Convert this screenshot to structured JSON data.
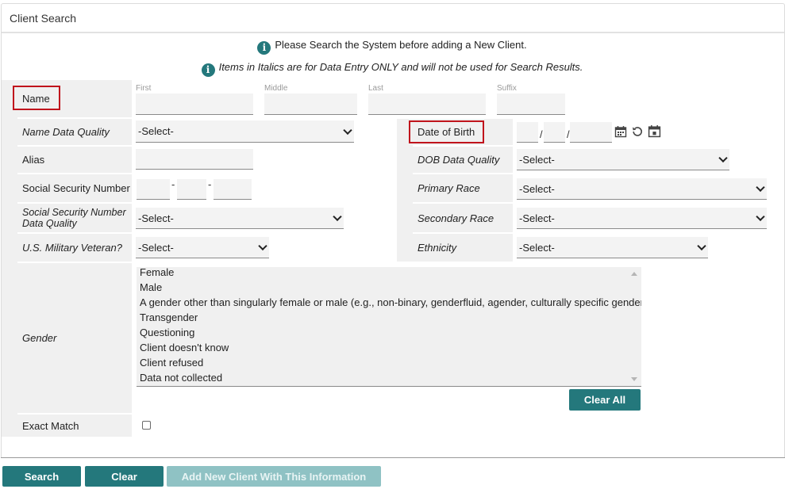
{
  "header": {
    "title": "Client Search"
  },
  "info": {
    "line1": "Please Search the System before adding a New Client.",
    "line2": "Items in Italics are for Data Entry ONLY and will not be used for Search Results.",
    "icon": "i"
  },
  "name": {
    "label": "Name",
    "first_label": "First",
    "middle_label": "Middle",
    "last_label": "Last",
    "suffix_label": "Suffix"
  },
  "fields": {
    "name_data_quality": {
      "label": "Name Data Quality",
      "value": "-Select-"
    },
    "alias": {
      "label": "Alias"
    },
    "ssn": {
      "label": "Social Security Number",
      "sep": "-"
    },
    "ssn_quality": {
      "label": "Social Security Number Data Quality",
      "value": "-Select-"
    },
    "veteran": {
      "label": "U.S. Military Veteran?",
      "value": "-Select-"
    },
    "gender": {
      "label": "Gender"
    },
    "exact_match": {
      "label": "Exact Match"
    },
    "dob": {
      "label": "Date of Birth",
      "sep": "/"
    },
    "dob_quality": {
      "label": "DOB Data Quality",
      "value": "-Select-"
    },
    "primary_race": {
      "label": "Primary Race",
      "value": "-Select-"
    },
    "secondary_race": {
      "label": "Secondary Race",
      "value": "-Select-"
    },
    "ethnicity": {
      "label": "Ethnicity",
      "value": "-Select-"
    }
  },
  "gender_options": [
    "Female",
    "Male",
    "A gender other than singularly female or male (e.g., non-binary, genderfluid, agender, culturally specific gender)",
    "Transgender",
    "Questioning",
    "Client doesn't know",
    "Client refused",
    "Data not collected"
  ],
  "buttons": {
    "clear_all": "Clear All",
    "search": "Search",
    "clear": "Clear",
    "add_new": "Add New Client With This Information"
  },
  "colors": {
    "accent": "#24787c",
    "accent_disabled": "#8fc2c4",
    "highlight_box": "#c0141c",
    "label_bg": "#f0f0f0"
  }
}
